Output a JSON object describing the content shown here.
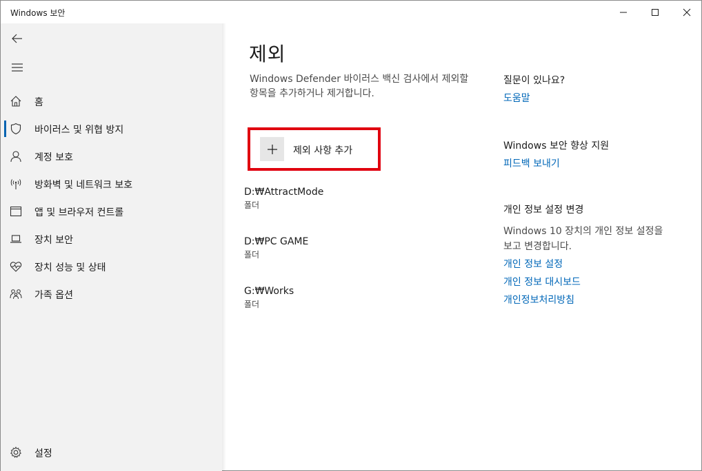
{
  "window": {
    "title": "Windows 보안"
  },
  "sidebar": {
    "back_icon": "back-arrow-icon",
    "menu_icon": "hamburger-icon",
    "items": [
      {
        "label": "홈",
        "icon": "home-icon",
        "active": false
      },
      {
        "label": "바이러스 및 위협 방지",
        "icon": "shield-icon",
        "active": true
      },
      {
        "label": "계정 보호",
        "icon": "person-icon",
        "active": false
      },
      {
        "label": "방화벽 및 네트워크 보호",
        "icon": "wireless-icon",
        "active": false
      },
      {
        "label": "앱 및 브라우저 컨트롤",
        "icon": "app-window-icon",
        "active": false
      },
      {
        "label": "장치 보안",
        "icon": "laptop-icon",
        "active": false
      },
      {
        "label": "장치 성능 및 상태",
        "icon": "heart-pulse-icon",
        "active": false
      },
      {
        "label": "가족 옵션",
        "icon": "family-icon",
        "active": false
      }
    ],
    "settings_label": "설정",
    "settings_icon": "gear-icon"
  },
  "main": {
    "title": "제외",
    "description": "Windows Defender 바이러스 백신 검사에서 제외할 항목을 추가하거나 제거합니다.",
    "add_button_label": "제외 사항 추가",
    "exclusions": [
      {
        "path": "D:₩AttractMode",
        "type": "폴더"
      },
      {
        "path": "D:₩PC GAME",
        "type": "폴더"
      },
      {
        "path": "G:₩Works",
        "type": "폴더"
      }
    ]
  },
  "right": {
    "question_heading": "질문이 있나요?",
    "help_link": "도움말",
    "improve_heading": "Windows 보안 향상 지원",
    "feedback_link": "피드백 보내기",
    "privacy_heading": "개인 정보 설정 변경",
    "privacy_text": "Windows 10 장치의 개인 정보 설정을 보고 변경합니다.",
    "privacy_links": [
      "개인 정보 설정",
      "개인 정보 대시보드",
      "개인정보처리방침"
    ]
  },
  "colors": {
    "accent": "#0063b1",
    "link": "#0067b8",
    "highlight_box": "#e0000f",
    "sidebar_bg": "#f2f2f2"
  }
}
